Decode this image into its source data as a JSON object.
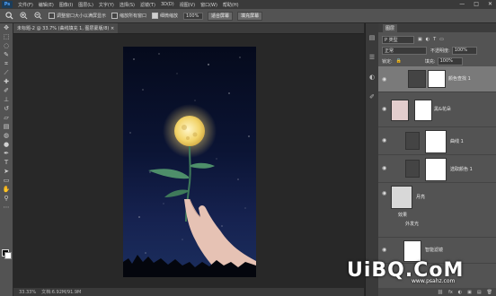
{
  "menubar": {
    "logo": "Ps",
    "items": [
      "文件(F)",
      "编辑(E)",
      "图像(I)",
      "图层(L)",
      "文字(Y)",
      "选择(S)",
      "滤镜(T)",
      "3D(D)",
      "视图(V)",
      "窗口(W)",
      "帮助(H)"
    ],
    "minimize": "—",
    "maximize": "□",
    "close": "✕"
  },
  "options": {
    "checkbox1_label": "调整窗口大小以满屏显示",
    "checkbox2_label": "缩放所有窗口",
    "checkbox3_label": "细微缩放",
    "zoom_value": "100%",
    "fit_screen_button": "适合屏幕",
    "fill_screen_button": "填充屏幕"
  },
  "document": {
    "tab_title": "未标题-2 @ 33.7% (曲线填充 1, 图层蒙版/8) ×"
  },
  "status": {
    "zoom": "33.33%",
    "doc_info": "文档:6.92M/91.9M"
  },
  "layers_panel": {
    "title": "图层",
    "kind_label": "P 类型",
    "blend_mode": "正常",
    "opacity_label": "不透明度:",
    "opacity_value": "100%",
    "lock_label": "锁定:",
    "fill_label": "填充:",
    "fill_value": "100%",
    "layers": [
      {
        "name": "颜色查找 1",
        "eye": "◉"
      },
      {
        "name": "黑&花朵",
        "eye": "◉"
      },
      {
        "name": "曲线 1",
        "eye": "◉"
      },
      {
        "name": "选取颜色 1",
        "eye": "◉"
      },
      {
        "name": "月亮",
        "eye": "◉"
      },
      {
        "name": "效果",
        "eye": "◉"
      },
      {
        "name": "外发光",
        "eye": "◉"
      },
      {
        "name": "智能滤镜",
        "eye": "◉"
      }
    ],
    "footer_icons": [
      "⛓",
      "fx",
      "◐",
      "▣",
      "▤",
      "🗑"
    ]
  },
  "watermark": {
    "main": "UiBQ.CoM",
    "sub": "www.psahz.com"
  },
  "colors": {
    "accent": "#4fa3ff",
    "moon": "#f6d777",
    "sky_top": "#050a1c",
    "sky_bottom": "#1b2e5e"
  }
}
